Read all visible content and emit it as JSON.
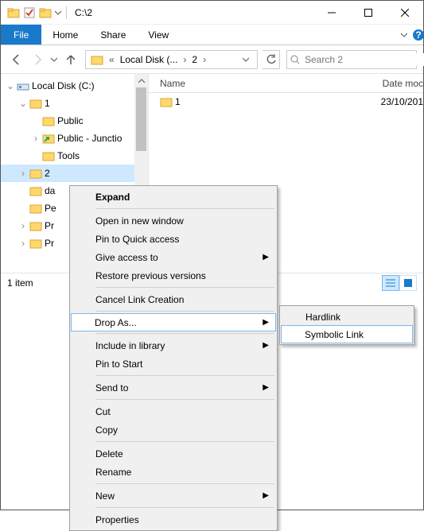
{
  "titlebar": {
    "path": "C:\\2"
  },
  "ribbon": {
    "file": "File",
    "home": "Home",
    "share": "Share",
    "view": "View"
  },
  "address": {
    "seg1": "Local Disk (...",
    "seg2": "2"
  },
  "search": {
    "placeholder": "Search 2"
  },
  "tree": {
    "root": "Local Disk (C:)",
    "items": [
      "1",
      "Public",
      "Public - Junctio",
      "Tools",
      "2",
      "da",
      "Pe",
      "Pr",
      "Pr"
    ]
  },
  "list": {
    "col_name": "Name",
    "col_date": "Date moc",
    "rows": [
      {
        "name": "1",
        "date": "23/10/201"
      }
    ]
  },
  "status": {
    "count": "1 item"
  },
  "menu": {
    "expand": "Expand",
    "open_new": "Open in new window",
    "pin_qa": "Pin to Quick access",
    "give_access": "Give access to",
    "restore": "Restore previous versions",
    "cancel_link": "Cancel Link Creation",
    "drop_as": "Drop As...",
    "include_lib": "Include in library",
    "pin_start": "Pin to Start",
    "send_to": "Send to",
    "cut": "Cut",
    "copy": "Copy",
    "delete": "Delete",
    "rename": "Rename",
    "new": "New",
    "properties": "Properties"
  },
  "submenu": {
    "hardlink": "Hardlink",
    "symlink": "Symbolic Link"
  }
}
